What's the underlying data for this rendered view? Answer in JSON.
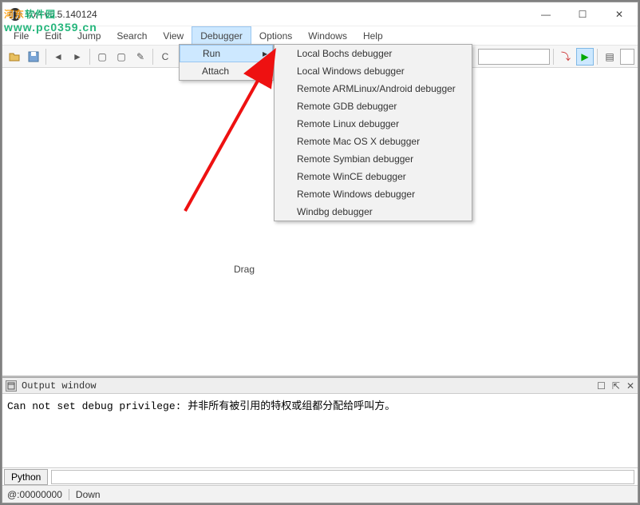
{
  "title": "IDA v6.5.140124",
  "menubar": [
    "File",
    "Edit",
    "Jump",
    "Search",
    "View",
    "Debugger",
    "Options",
    "Windows",
    "Help"
  ],
  "menubar_active_index": 5,
  "submenu_debugger": [
    {
      "label": "Run",
      "has_children": true,
      "selected": true
    },
    {
      "label": "Attach",
      "has_children": true,
      "selected": false
    }
  ],
  "submenu_run": [
    "Local Bochs debugger",
    "Local Windows debugger",
    "Remote ARMLinux/Android debugger",
    "Remote GDB debugger",
    "Remote Linux debugger",
    "Remote Mac OS X debugger",
    "Remote Symbian debugger",
    "Remote WinCE debugger",
    "Remote Windows debugger",
    "Windbg debugger"
  ],
  "drag_hint": "Drag",
  "output": {
    "title": "Output window",
    "text": "Can not set debug privilege: 并非所有被引用的特权或组都分配给呼叫方。"
  },
  "cmd_label": "Python",
  "cmd_value": "",
  "status": {
    "addr": "@:00000000",
    "state": "Down"
  },
  "watermark": {
    "line1a": "河东",
    "line1b": "软件园",
    "line2": "www.pc0359.cn"
  },
  "icons": {
    "min": "—",
    "max": "☐",
    "close": "✕",
    "expand": "▸",
    "panel_min": "☐",
    "panel_pin": "⇱",
    "panel_close": "✕"
  }
}
